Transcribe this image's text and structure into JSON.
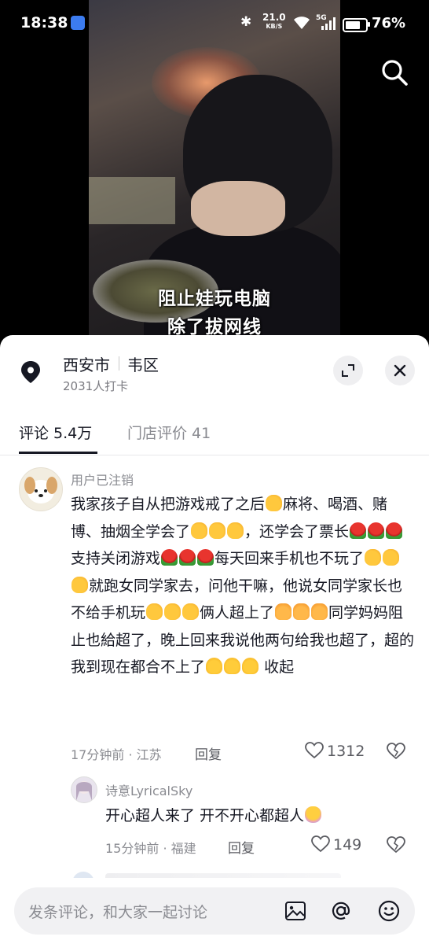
{
  "status_bar": {
    "time": "18:38",
    "net_speed": "21.0",
    "net_unit": "KB/S",
    "signal_label": "5G",
    "battery": "76%"
  },
  "video": {
    "caption_line1": "阻止娃玩电脑",
    "caption_line2": "除了拔网线",
    "search_icon": "search-icon"
  },
  "location": {
    "city": "西安市",
    "district": "韦区",
    "checkins": "2031人打卡",
    "icon": "location-pin-icon"
  },
  "tabs": [
    {
      "label": "评论 5.4万",
      "active": true
    },
    {
      "label": "门店评价 41",
      "active": false
    }
  ],
  "comments": [
    {
      "username": "用户已注销",
      "segments": [
        "我家孩子自从把游戏戒了之后",
        "麻将、喝酒、赌博、抽烟全学会了",
        "，还学会了票长",
        "支持关闭游戏",
        "每天回来手机也不玩了",
        "就跑女同学家去，问他干嘛，他说女同学家长也不给手机玩",
        "俩人超上了",
        "同学妈妈阻止也給超了，晚上回来我说他两句给我也超了，超的我到现在都合不上了"
      ],
      "collapse_label": "收起",
      "time_location": "17分钟前 · 江苏",
      "reply_label": "回复",
      "likes": "1312"
    },
    {
      "username": "诗意LyricalSky",
      "text": "开心超人来了 开不开心都超人",
      "time_location": "15分钟前 · 福建",
      "reply_label": "回复",
      "likes": "149"
    }
  ],
  "input": {
    "placeholder": "发条评论，和大家一起讨论"
  }
}
